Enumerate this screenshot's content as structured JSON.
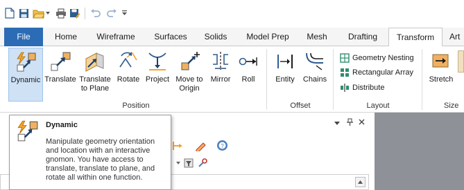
{
  "quick_access": {
    "icons": [
      "new-file-icon",
      "save-icon",
      "open-folder-icon",
      "dropdown-arrow-icon",
      "print-icon",
      "save-as-icon",
      "undo-icon",
      "redo-icon",
      "customize-toolbar-icon"
    ]
  },
  "tabs": [
    {
      "label": "File"
    },
    {
      "label": "Home"
    },
    {
      "label": "Wireframe"
    },
    {
      "label": "Surfaces"
    },
    {
      "label": "Solids"
    },
    {
      "label": "Model Prep"
    },
    {
      "label": "Mesh"
    },
    {
      "label": "Drafting"
    },
    {
      "label": "Transform"
    },
    {
      "label": "Art"
    }
  ],
  "active_tab": "Transform",
  "ribbon": {
    "position_group": {
      "label": "Position",
      "buttons": [
        {
          "label": "Dynamic",
          "icon": "dynamic-gnomon-icon",
          "selected": true
        },
        {
          "label": "Translate",
          "icon": "translate-icon"
        },
        {
          "label": "Translate\nto Plane",
          "icon": "translate-to-plane-icon"
        },
        {
          "label": "Rotate",
          "icon": "rotate-icon"
        },
        {
          "label": "Project",
          "icon": "project-icon"
        },
        {
          "label": "Move to\nOrigin",
          "icon": "move-to-origin-icon"
        },
        {
          "label": "Mirror",
          "icon": "mirror-icon"
        },
        {
          "label": "Roll",
          "icon": "roll-icon"
        }
      ]
    },
    "offset_group": {
      "label": "Offset",
      "buttons": [
        {
          "label": "Entity",
          "icon": "offset-entity-icon"
        },
        {
          "label": "Chains",
          "icon": "offset-chains-icon"
        }
      ]
    },
    "layout_group": {
      "label": "Layout",
      "buttons": [
        {
          "label": "Geometry Nesting",
          "icon": "geometry-nesting-icon"
        },
        {
          "label": "Rectangular Array",
          "icon": "rectangular-array-icon"
        },
        {
          "label": "Distribute",
          "icon": "distribute-icon"
        }
      ]
    },
    "size_group": {
      "label": "Size",
      "buttons": [
        {
          "label": "Stretch",
          "icon": "stretch-icon"
        }
      ]
    }
  },
  "panel": {
    "controls": [
      "dropdown-icon",
      "pin-icon",
      "close-icon"
    ]
  },
  "tooltip": {
    "title": "Dynamic",
    "description": "Manipulate geometry orientation and location with an interactive gnomon. You have access to translate, translate to plane, and rotate all within one function."
  },
  "colors": {
    "file_tab": "#2b6cb5",
    "selected_button": "#cfe1f5",
    "accent_orange": "#f0a430",
    "viewport_gray": "#8e9197"
  }
}
